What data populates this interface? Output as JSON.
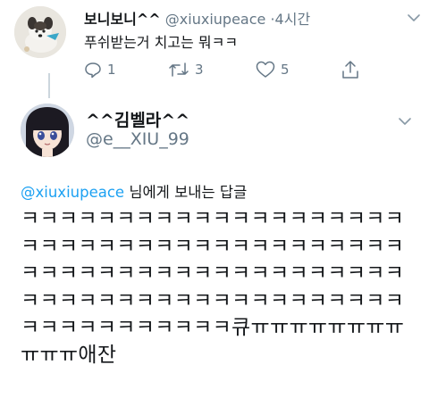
{
  "original_tweet": {
    "display_name": "보니보니^^",
    "handle": "@xiuxiupeace",
    "separator": "·",
    "time": "4시간",
    "text": "푸쉬받는거 치고는 뭐ㅋㅋ",
    "reply_count": "1",
    "retweet_count": "3",
    "like_count": "5",
    "icons": [
      "caret-down-icon",
      "reply-icon",
      "retweet-icon",
      "like-icon",
      "share-icon"
    ]
  },
  "reply_tweet": {
    "display_name": "^^김벨라^^",
    "handle": "@e__XIU_99",
    "replying_to_handle": "@xiuxiupeace",
    "replying_to_suffix": " 님에게 보내는 답글",
    "text": "ㅋㅋㅋㅋㅋㅋㅋㅋㅋㅋㅋㅋㅋㅋㅋㅋㅋㅋㅋㅋㅋㅋㅋㅋㅋㅋㅋㅋㅋㅋㅋㅋㅋㅋㅋㅋㅋㅋㅋㅋㅋㅋㅋㅋㅋㅋㅋㅋㅋㅋㅋㅋㅋㅋㅋㅋㅋㅋㅋㅋㅋㅋㅋㅋㅋㅋㅋㅋㅋㅋㅋㅋㅋㅋㅋㅋㅋㅋㅋㅋㅋㅋㅋㅋㅋㅋㅋㅋㅋㅋㅋ큐ㅠㅠㅠㅠㅠㅠㅠㅠㅠㅠㅠ애잔"
  },
  "colors": {
    "accent": "#1da1f2",
    "secondary_text": "#657786",
    "thread_line": "#ccd6dd"
  }
}
